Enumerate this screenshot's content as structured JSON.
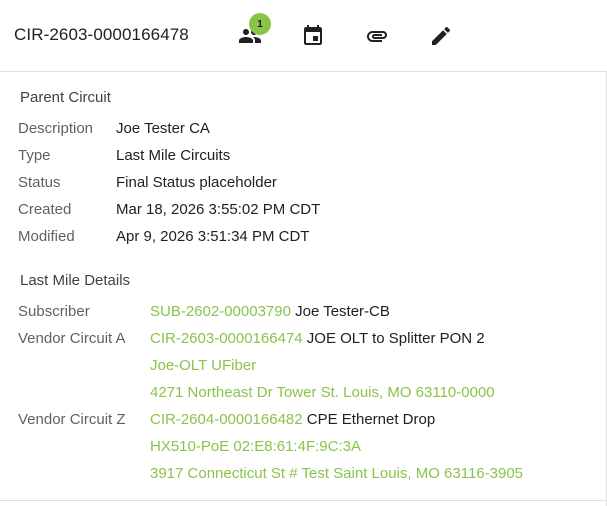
{
  "header": {
    "circuit_id": "CIR-2603-0000166478",
    "contacts_badge": "1",
    "icons": [
      "people-icon",
      "calendar-icon",
      "attachment-icon",
      "edit-icon"
    ]
  },
  "parent": {
    "title": "Parent Circuit",
    "description_label": "Description",
    "description": "Joe Tester CA",
    "type_label": "Type",
    "type": "Last Mile Circuits",
    "status_label": "Status",
    "status": "Final Status placeholder",
    "created_label": "Created",
    "created": "Mar 18, 2026 3:55:02 PM CDT",
    "modified_label": "Modified",
    "modified": "Apr 9, 2026 3:51:34 PM CDT"
  },
  "last_mile": {
    "title": "Last Mile Details",
    "subscriber_label": "Subscriber",
    "subscriber_id": "SUB-2602-00003790",
    "subscriber_name": "Joe Tester-CB",
    "vendor_a_label": "Vendor Circuit A",
    "vendor_a_id": "CIR-2603-0000166474",
    "vendor_a_name": "JOE OLT to Splitter PON 2",
    "vendor_a_device": "Joe-OLT UFiber",
    "vendor_a_address": "4271 Northeast Dr Tower St. Louis, MO 63110-0000",
    "vendor_z_label": "Vendor Circuit Z",
    "vendor_z_id": "CIR-2604-0000166482",
    "vendor_z_name": "CPE Ethernet Drop",
    "vendor_z_device": "HX510-PoE 02:E8:61:4F:9C:3A",
    "vendor_z_address": "3917 Connecticut St # Test Saint Louis, MO 63116-3905"
  },
  "colors": {
    "link": "#8bc34a",
    "badge": "#8bc34a"
  }
}
